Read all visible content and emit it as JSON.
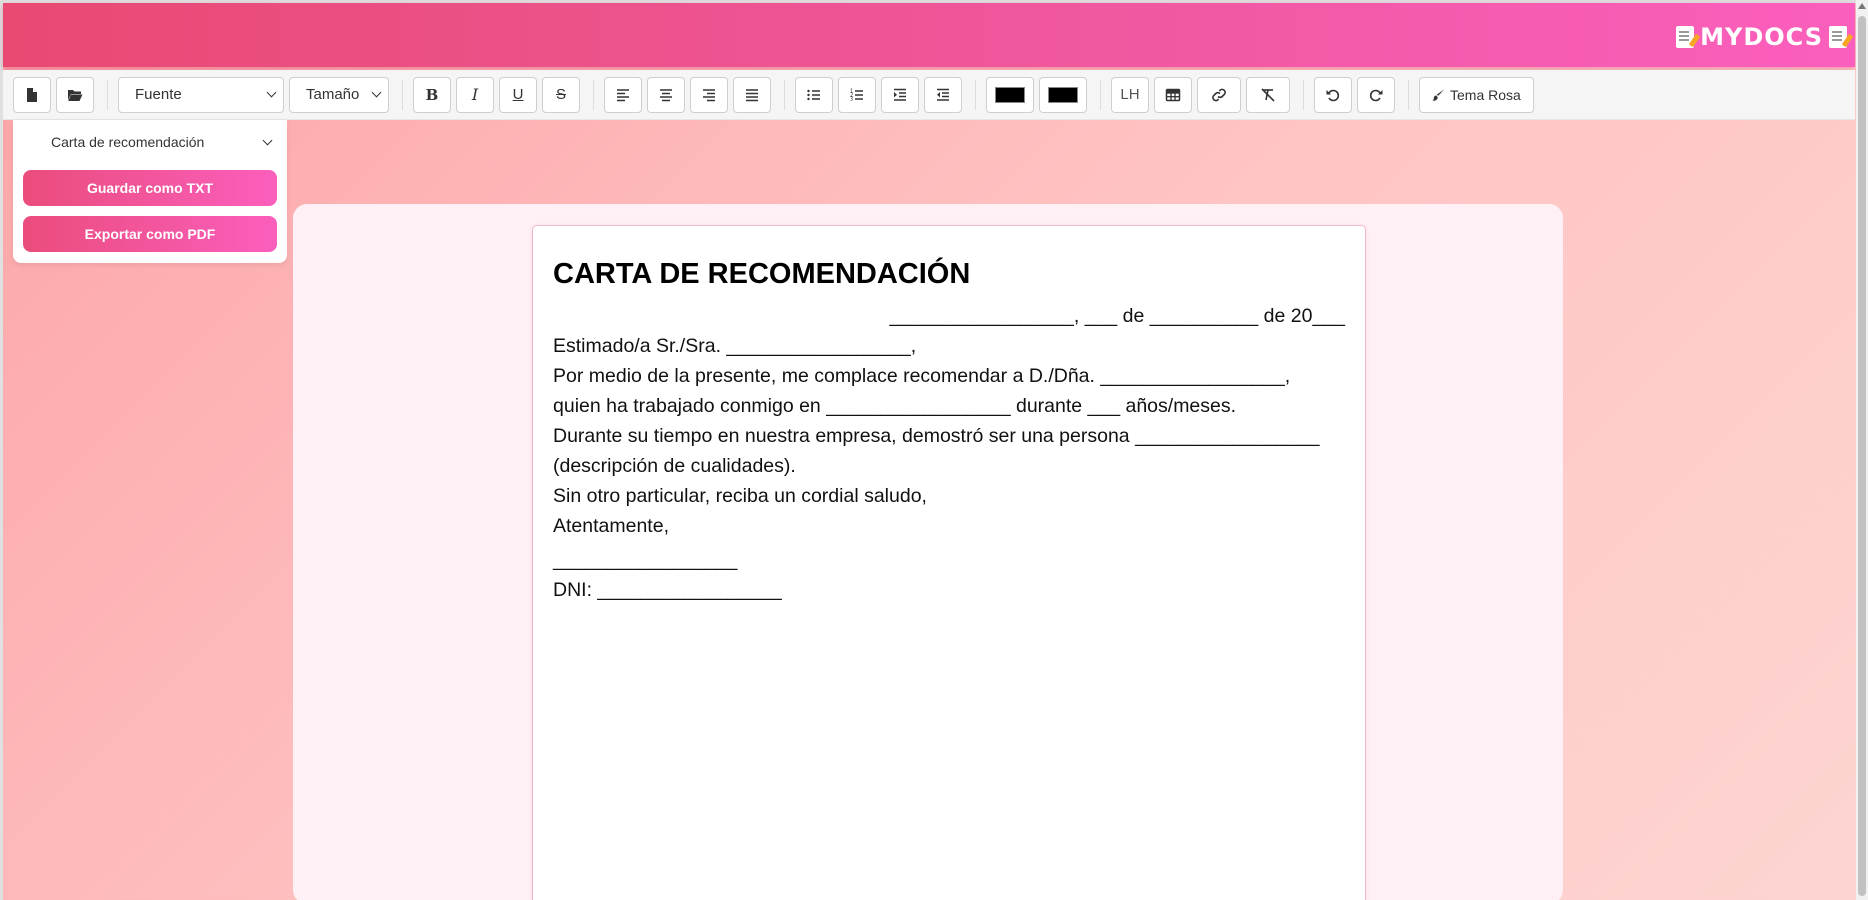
{
  "brand": {
    "name": "MYDOCS"
  },
  "icons": {
    "brand_left": "memo-icon",
    "brand_right": "memo-icon",
    "new_doc": "file-icon",
    "open_doc": "folder-open-icon",
    "bold": "bold-icon",
    "italic": "italic-icon",
    "underline": "underline-icon",
    "strike": "strikethrough-icon",
    "align_left": "align-left-icon",
    "align_center": "align-center-icon",
    "align_right": "align-right-icon",
    "align_justify": "align-justify-icon",
    "list_bullet": "list-bullet-icon",
    "list_ordered": "list-ordered-icon",
    "indent": "indent-icon",
    "outdent": "outdent-icon",
    "table": "table-icon",
    "link": "link-icon",
    "clear_format": "clear-format-icon",
    "undo": "undo-icon",
    "redo": "redo-icon",
    "theme": "paintbrush-icon"
  },
  "toolbar": {
    "font_select": "Fuente",
    "size_select": "Tamaño",
    "bold_label": "B",
    "italic_label": "I",
    "underline_label": "U",
    "strike_label": "S",
    "text_color": "#000000",
    "highlight_color": "#000000",
    "line_height_label": "LH",
    "theme_label": "Tema Rosa"
  },
  "side_panel": {
    "template_select": "Carta de recomendación",
    "save_txt_label": "Guardar como TXT",
    "export_pdf_label": "Exportar como PDF"
  },
  "document": {
    "title": "CARTA DE RECOMENDACIÓN",
    "date_line": "_________________, ___ de __________ de 20___",
    "lines": [
      "Estimado/a Sr./Sra. _________________,",
      "Por medio de la presente, me complace recomendar a D./Dña. _________________,",
      "quien ha trabajado conmigo en _________________ durante ___ años/meses.",
      "Durante su tiempo en nuestra empresa, demostró ser una persona _________________",
      "(descripción de cualidades).",
      "Sin otro particular, reciba un cordial saludo,",
      "Atentamente,"
    ],
    "signature_line": "_________________",
    "dni_line": "DNI: _________________"
  },
  "colors": {
    "header_start": "#e84a72",
    "header_end": "#fb5fbd",
    "accent": "#f058a0"
  }
}
